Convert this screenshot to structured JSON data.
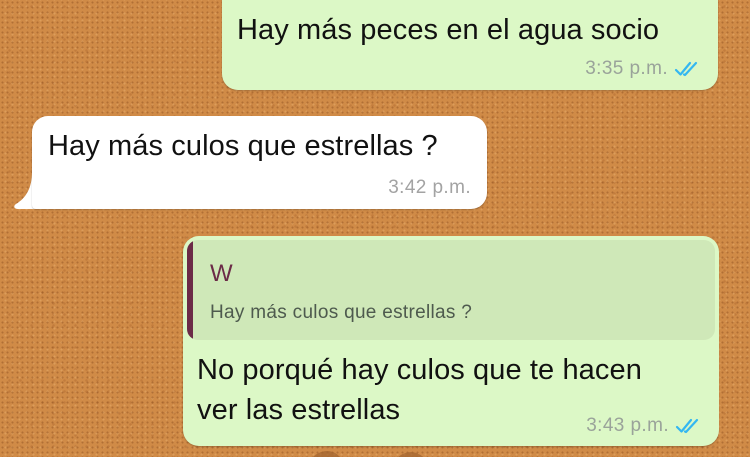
{
  "messages": [
    {
      "direction": "outgoing",
      "text": "Hay más peces en el agua socio",
      "time": "3:35 p.m.",
      "status": "read"
    },
    {
      "direction": "incoming",
      "text": "Hay más culos que estrellas ?",
      "time": "3:42 p.m."
    },
    {
      "direction": "outgoing",
      "reply": {
        "author": "W",
        "text": "Hay más culos que estrellas ?"
      },
      "text_line1": "No porqué hay culos que te hacen",
      "text_line2": "ver las estrellas",
      "time": "3:43 p.m.",
      "status": "read"
    }
  ],
  "colors": {
    "outgoing_bubble": "#dcf8c6",
    "incoming_bubble": "#ffffff",
    "quote_background": "#cfe8b8",
    "quote_accent": "#6b2b47",
    "read_ticks": "#34b7f1",
    "wallpaper": "#d08b47"
  },
  "icons": {
    "read_receipt": "double-check-icon"
  }
}
